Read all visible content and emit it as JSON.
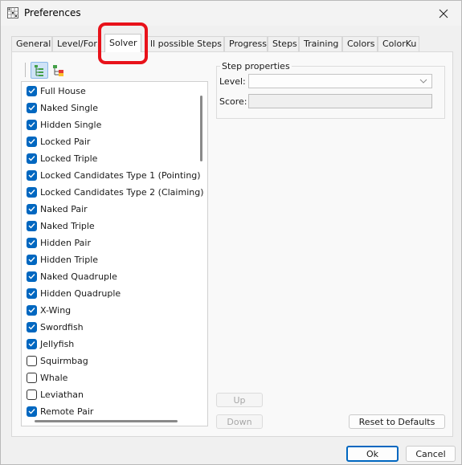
{
  "window": {
    "title": "Preferences"
  },
  "tabs": [
    {
      "label": "General",
      "active": false
    },
    {
      "label": "Level/For",
      "active": false
    },
    {
      "label": "Solver",
      "active": true
    },
    {
      "label": "ll possible Steps",
      "active": false
    },
    {
      "label": "Progress",
      "active": false
    },
    {
      "label": "Steps",
      "active": false
    },
    {
      "label": "Training",
      "active": false
    },
    {
      "label": "Colors",
      "active": false
    },
    {
      "label": "ColorKu",
      "active": false
    }
  ],
  "toolbar": {
    "icons": [
      "tree-view-icon",
      "hierarchy-view-icon"
    ]
  },
  "steps": [
    {
      "label": "Full House",
      "checked": true
    },
    {
      "label": "Naked Single",
      "checked": true
    },
    {
      "label": "Hidden Single",
      "checked": true
    },
    {
      "label": "Locked Pair",
      "checked": true
    },
    {
      "label": "Locked Triple",
      "checked": true
    },
    {
      "label": "Locked Candidates Type 1 (Pointing)",
      "checked": true
    },
    {
      "label": "Locked Candidates Type 2 (Claiming)",
      "checked": true
    },
    {
      "label": "Naked Pair",
      "checked": true
    },
    {
      "label": "Naked Triple",
      "checked": true
    },
    {
      "label": "Hidden Pair",
      "checked": true
    },
    {
      "label": "Hidden Triple",
      "checked": true
    },
    {
      "label": "Naked Quadruple",
      "checked": true
    },
    {
      "label": "Hidden Quadruple",
      "checked": true
    },
    {
      "label": "X-Wing",
      "checked": true
    },
    {
      "label": "Swordfish",
      "checked": true
    },
    {
      "label": "Jellyfish",
      "checked": true
    },
    {
      "label": "Squirmbag",
      "checked": false
    },
    {
      "label": "Whale",
      "checked": false
    },
    {
      "label": "Leviathan",
      "checked": false
    },
    {
      "label": "Remote Pair",
      "checked": true
    }
  ],
  "step_properties": {
    "title": "Step properties",
    "level_label": "Level:",
    "level_value": "",
    "score_label": "Score:",
    "score_value": ""
  },
  "buttons": {
    "up": "Up",
    "down": "Down",
    "reset": "Reset to Defaults",
    "ok": "Ok",
    "cancel": "Cancel"
  },
  "colors": {
    "accent": "#0067c0",
    "highlight": "#e8121a"
  }
}
